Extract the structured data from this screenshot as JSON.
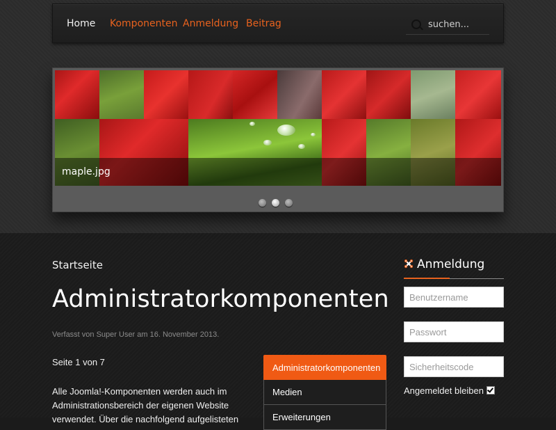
{
  "nav": {
    "items": [
      {
        "label": "Home",
        "active": true
      },
      {
        "label": "Komponenten"
      },
      {
        "label": "Anmeldung"
      },
      {
        "label": "Beitrag"
      }
    ],
    "search_placeholder": "suchen..."
  },
  "slider": {
    "caption": "maple.jpg",
    "dots_total": 3,
    "active_dot": 2
  },
  "article": {
    "breadcrumb": "Startseite",
    "title": "Administratorkomponenten",
    "meta": "Verfasst von Super User am 16. November 2013.",
    "page_of": "Seite 1 von 7",
    "body": "Alle Joomla!-Komponenten werden auch im Administrationsbereich der eigenen Website verwendet. Über die nachfolgend aufgelisteten"
  },
  "toc": {
    "items": [
      "Administratorkomponenten",
      "Medien",
      "Erweiterungen"
    ]
  },
  "login": {
    "heading": "Anmeldung",
    "username_placeholder": "Benutzername",
    "password_placeholder": "Passwort",
    "security_placeholder": "Sicherheitscode",
    "remember_label": "Angemeldet bleiben",
    "remember_checked": true
  },
  "colors": {
    "accent": "#e8621e",
    "toc_active": "#f05a14"
  }
}
